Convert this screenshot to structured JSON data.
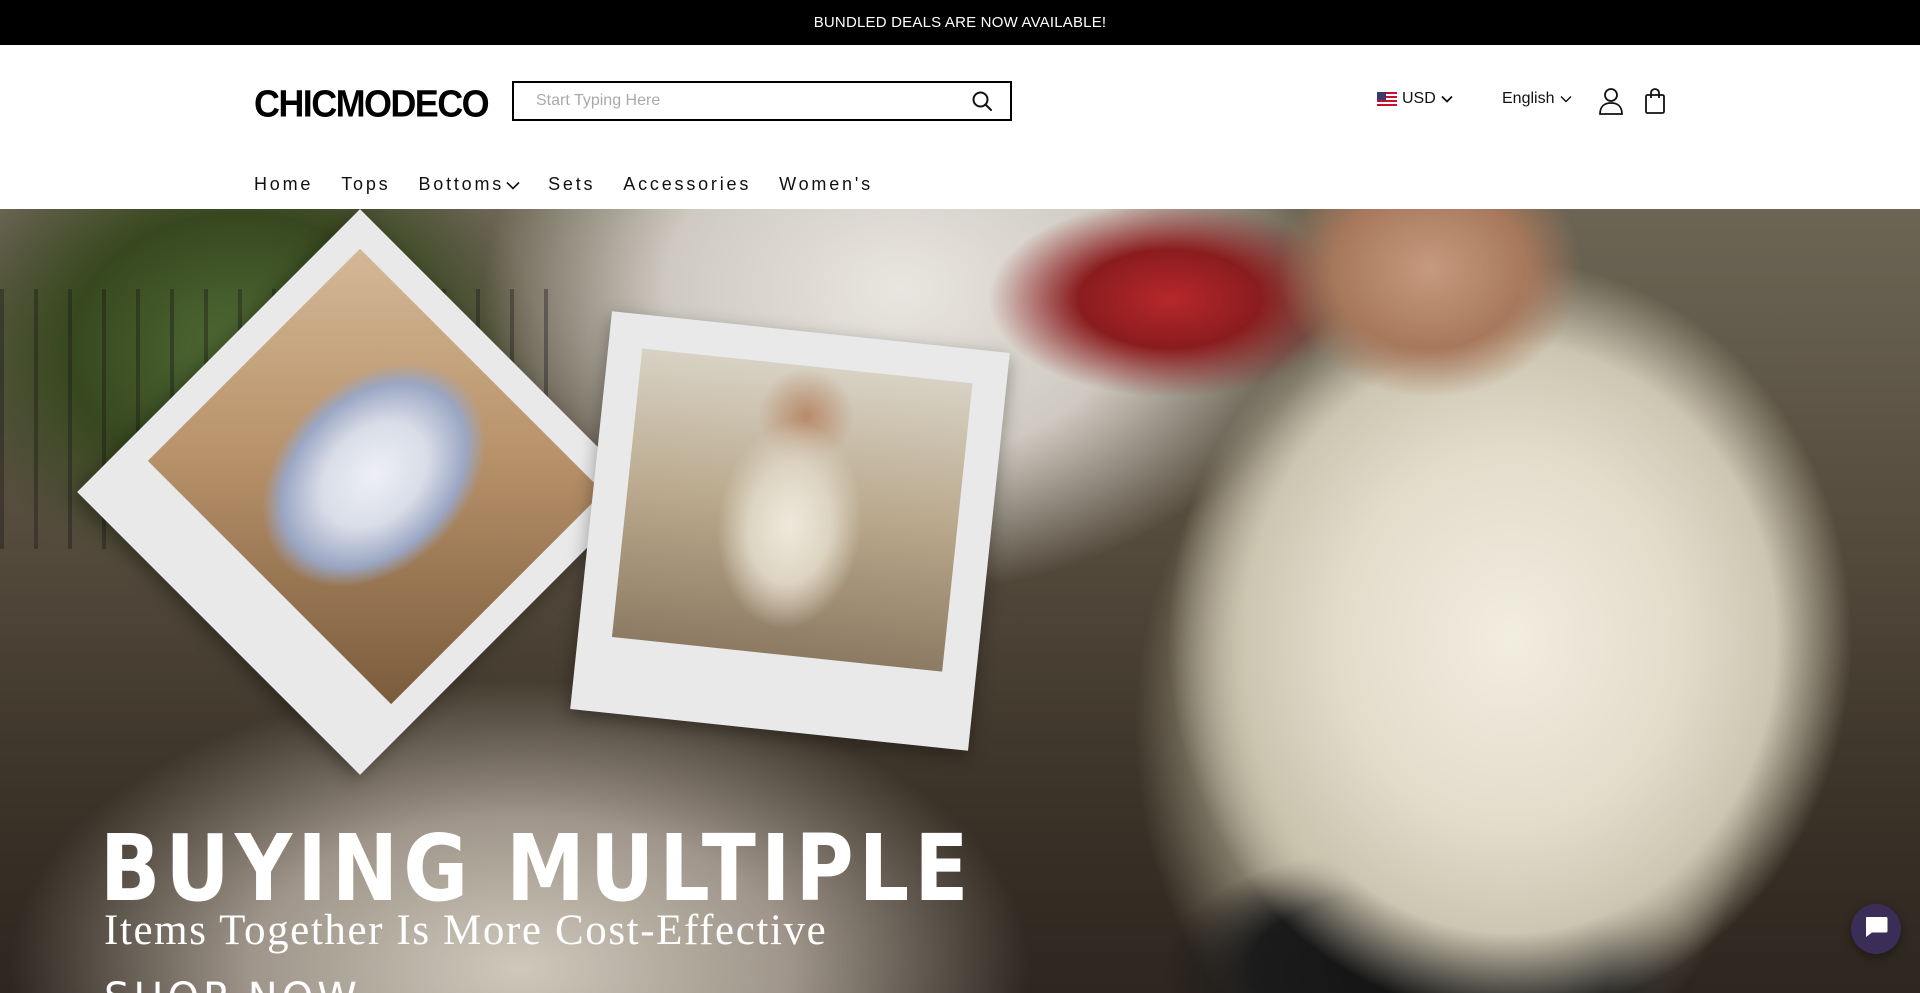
{
  "announcement": {
    "text": "BUNDLED DEALS ARE NOW AVAILABLE!"
  },
  "header": {
    "logo": "CHICMODECO",
    "search": {
      "placeholder": "Start Typing Here",
      "value": ""
    },
    "currency": "USD",
    "language": "English"
  },
  "nav": {
    "items": [
      {
        "label": "Home"
      },
      {
        "label": "Tops"
      },
      {
        "label": "Bottoms"
      },
      {
        "label": "Sets"
      },
      {
        "label": "Accessories"
      },
      {
        "label": "Women's"
      }
    ]
  },
  "hero": {
    "headline": "BUYING MULTIPLE",
    "subheadline": "Items Together Is More Cost-Effective",
    "cta": "SHOP NOW"
  },
  "icons": {
    "search": "search-icon",
    "flag": "us-flag-icon",
    "currency_dropdown": "chevron-down-icon",
    "language_dropdown": "chevron-down-icon",
    "account": "user-icon",
    "cart": "shopping-bag-icon",
    "bottoms_dropdown": "chevron-down-icon",
    "chat": "chat-icon"
  },
  "colors": {
    "announcement_bg": "#000000",
    "header_bg": "#ffffff",
    "chat_button": "#3a2e58"
  }
}
